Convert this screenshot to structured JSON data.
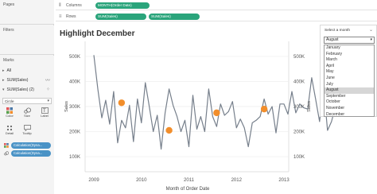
{
  "left_pane": {
    "pages_label": "Pages",
    "filters_label": "Filters",
    "marks": {
      "title": "Marks",
      "rows": [
        {
          "label": "All",
          "icon": "chevron-icon"
        },
        {
          "label": "SUM(Sales)",
          "icon": "line-mark-icon"
        },
        {
          "label": "SUM(Sales) (2)",
          "icon": "dots-mark-icon"
        }
      ],
      "mark_type": "Circle",
      "buttons": [
        {
          "label": "Color",
          "icon": "color-palette-icon"
        },
        {
          "label": "Size",
          "icon": "size-circles-icon"
        },
        {
          "label": "Label",
          "icon": "text-label-icon"
        },
        {
          "label": "Detail",
          "icon": "detail-dots-icon"
        },
        {
          "label": "Tooltip",
          "icon": "tooltip-bubble-icon"
        }
      ],
      "pills": [
        {
          "label": "Calculation(Dyna...",
          "icon": "color-dots-icon"
        },
        {
          "label": "Calculation(Dyna...",
          "icon": "size-dots-icon"
        }
      ]
    }
  },
  "shelves": {
    "columns": {
      "label": "Columns",
      "pills": [
        "MONTH(Order Date)"
      ]
    },
    "rows": {
      "label": "Rows",
      "pills": [
        "SUM(Sales)",
        "SUM(Sales)"
      ]
    }
  },
  "viz": {
    "title": "Highlight December"
  },
  "parameter": {
    "title": "Select a month",
    "selected": "August",
    "options": [
      "January",
      "February",
      "March",
      "April",
      "May",
      "June",
      "July",
      "August",
      "September",
      "October",
      "November",
      "December"
    ]
  },
  "chart_data": {
    "type": "line",
    "title": "Highlight December",
    "xlabel": "Month of Order Date",
    "ylabel": "Sales",
    "y2label": "Sales",
    "x_ticks": [
      "2009",
      "2010",
      "2011",
      "2012",
      "2013"
    ],
    "y_ticks": [
      "500K",
      "400K",
      "300K",
      "200K",
      "100K"
    ],
    "ylim": [
      40000,
      560000
    ],
    "grid": true,
    "line_color": "#767f8b",
    "highlight_color": "#f28e2b",
    "series": [
      {
        "values": [
          505000,
          370000,
          255000,
          325000,
          230000,
          360000,
          155000,
          245000,
          215000,
          305000,
          160000,
          330000,
          235000,
          395000,
          300000,
          200000,
          265000,
          130000,
          275000,
          370000,
          305000,
          260000,
          200000,
          245000,
          140000,
          345000,
          210000,
          260000,
          200000,
          370000,
          260000,
          220000,
          310000,
          265000,
          280000,
          320000,
          215000,
          250000,
          215000,
          140000,
          235000,
          245000,
          260000,
          330000,
          270000,
          300000,
          195000,
          310000,
          310000,
          270000,
          360000,
          275000,
          310000,
          295000,
          290000,
          415000,
          330000,
          240000,
          380000,
          205000,
          240000,
          300000
        ]
      }
    ],
    "highlight_points": [
      {
        "x": "2009-08",
        "value": 315000
      },
      {
        "x": "2010-08",
        "value": 205000
      },
      {
        "x": "2011-08",
        "value": 275000
      },
      {
        "x": "2012-08",
        "value": 290000
      }
    ]
  },
  "y_axis_labels": {
    "left": [
      "500K",
      "400K",
      "300K",
      "200K",
      "100K"
    ],
    "right": [
      "500K",
      "400K",
      "300K",
      "200K",
      "100K"
    ]
  }
}
